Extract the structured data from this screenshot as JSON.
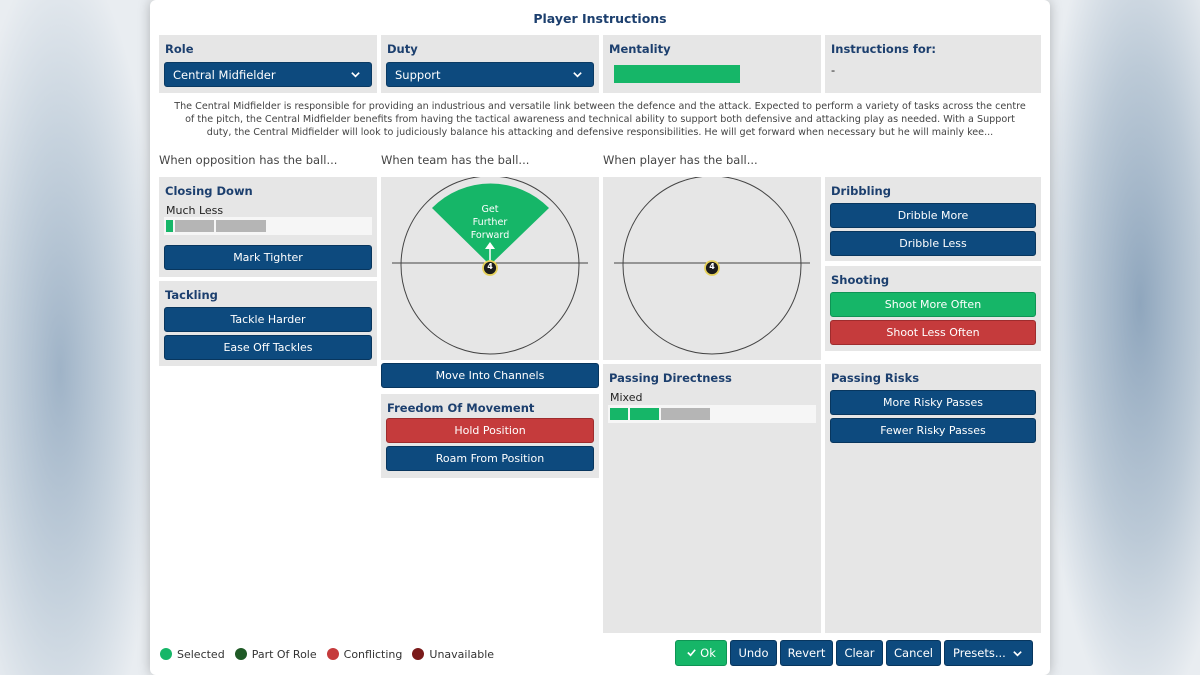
{
  "dialog": {
    "title": "Player Instructions"
  },
  "role": {
    "label": "Role",
    "value": "Central Midfielder"
  },
  "duty": {
    "label": "Duty",
    "value": "Support"
  },
  "mentality": {
    "label": "Mentality",
    "level_fraction": 1.0
  },
  "instructions_for": {
    "label": "Instructions for:",
    "value": "-"
  },
  "description": "The Central Midfielder is responsible for providing an industrious and versatile link between the defence and the attack. Expected to perform a variety of tasks across the centre of the pitch, the Central Midfielder benefits from having the tactical awareness and technical ability to support both defensive and attacking play as needed. With a Support duty, the Central Midfielder will look to judiciously balance his attacking and defensive responsibilities. He will get forward when necessary but he will mainly kee...",
  "sections": {
    "opposition": "When opposition has the ball...",
    "team": "When team has the ball...",
    "player": "When player has the ball..."
  },
  "closing_down": {
    "title": "Closing Down",
    "value_label": "Much Less",
    "level": 1,
    "of": 5,
    "mark_tighter": "Mark Tighter"
  },
  "tackling": {
    "title": "Tackling",
    "tackle_harder": "Tackle Harder",
    "ease_off": "Ease Off Tackles"
  },
  "team_pitch": {
    "zone_label_line1": "Get",
    "zone_label_line2": "Further",
    "zone_label_line3": "Forward",
    "player_number": "4"
  },
  "player_pitch": {
    "player_number": "4"
  },
  "move_into_channels": "Move Into Channels",
  "freedom": {
    "title": "Freedom Of Movement",
    "hold_position": "Hold Position",
    "roam": "Roam From Position"
  },
  "passing_directness": {
    "title": "Passing Directness",
    "value_label": "Mixed",
    "level": 2,
    "of": 5
  },
  "dribbling": {
    "title": "Dribbling",
    "more": "Dribble More",
    "less": "Dribble Less"
  },
  "shooting": {
    "title": "Shooting",
    "more": "Shoot More Often",
    "less": "Shoot Less Often"
  },
  "passing_risks": {
    "title": "Passing Risks",
    "more": "More Risky Passes",
    "fewer": "Fewer Risky Passes"
  },
  "legend": [
    {
      "label": "Selected",
      "color": "#16b668"
    },
    {
      "label": "Part Of Role",
      "color": "#1f5a26"
    },
    {
      "label": "Conflicting",
      "color": "#c53b3c"
    },
    {
      "label": "Unavailable",
      "color": "#7a1a1a"
    }
  ],
  "footer": {
    "ok": "Ok",
    "undo": "Undo",
    "revert": "Revert",
    "clear": "Clear",
    "cancel": "Cancel",
    "presets": "Presets..."
  },
  "colors": {
    "navy": "#0d4a7e",
    "selected_green": "#16b668",
    "conflict_red": "#c53b3c",
    "title_navy": "#1c3f6e"
  }
}
